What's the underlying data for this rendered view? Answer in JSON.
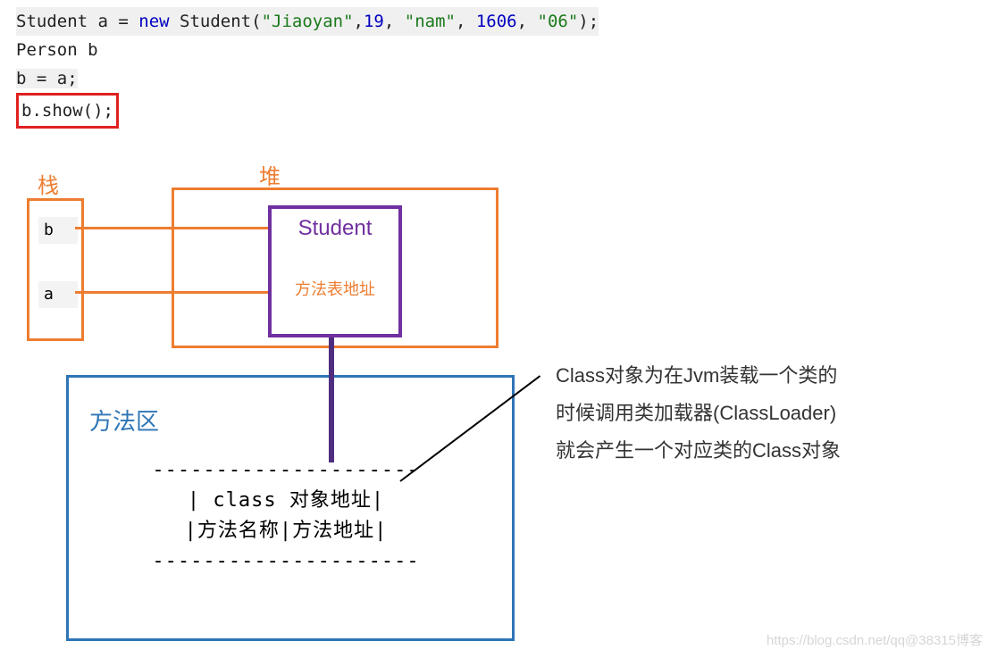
{
  "code": {
    "line1_pre": "Student a = ",
    "line1_new": "new",
    "line1_mid": " Student(",
    "line1_s1": "\"Jiaoyan\"",
    "line1_c1": ",",
    "line1_n1": "19",
    "line1_c2": ", ",
    "line1_s2": "\"nam\"",
    "line1_c3": ", ",
    "line1_n2": "1606",
    "line1_c4": ", ",
    "line1_s3": "\"06\"",
    "line1_end": ");",
    "line2": "Person b",
    "line3": "b = a;",
    "line4": "b.show();"
  },
  "labels": {
    "stack": "栈",
    "heap": "堆",
    "method_area": "方法区"
  },
  "stack": {
    "var_b": "b",
    "var_a": "a"
  },
  "heap_obj": {
    "title": "Student",
    "subtitle": "方法表地址"
  },
  "method_table": {
    "border": "---------------------",
    "row1": "| class 对象地址|",
    "row2": "|方法名称|方法地址|",
    "border2": "---------------------"
  },
  "description": {
    "l1": "Class对象为在Jvm装载一个类的",
    "l2": "时候调用类加载器(ClassLoader)",
    "l3": "就会产生一个对应类的Class对象"
  },
  "watermark": "https://blog.csdn.net/qq@38315博客"
}
